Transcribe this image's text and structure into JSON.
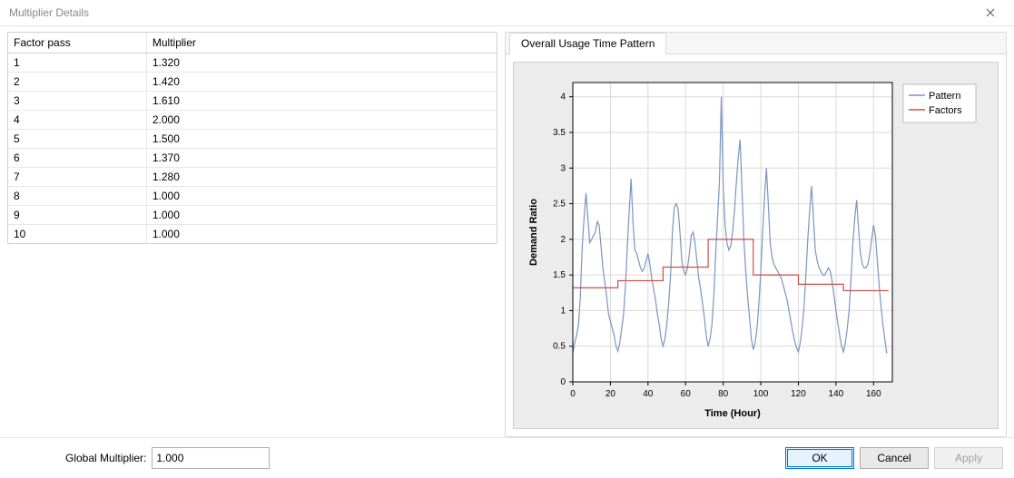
{
  "window": {
    "title": "Multiplier Details"
  },
  "table": {
    "headers": {
      "col0": "Factor pass",
      "col1": "Multiplier"
    },
    "rows": [
      {
        "pass": "1",
        "mult": "1.320"
      },
      {
        "pass": "2",
        "mult": "1.420"
      },
      {
        "pass": "3",
        "mult": "1.610"
      },
      {
        "pass": "4",
        "mult": "2.000"
      },
      {
        "pass": "5",
        "mult": "1.500"
      },
      {
        "pass": "6",
        "mult": "1.370"
      },
      {
        "pass": "7",
        "mult": "1.280"
      },
      {
        "pass": "8",
        "mult": "1.000"
      },
      {
        "pass": "9",
        "mult": "1.000"
      },
      {
        "pass": "10",
        "mult": "1.000"
      }
    ]
  },
  "tabs": {
    "overall": "Overall Usage Time Pattern"
  },
  "footer": {
    "global_label": "Global Multiplier:",
    "global_value": "1.000",
    "ok": "OK",
    "cancel": "Cancel",
    "apply": "Apply"
  },
  "chart_data": {
    "type": "line",
    "title": "",
    "xlabel": "Time (Hour)",
    "ylabel": "Demand Ratio",
    "xlim": [
      0,
      170
    ],
    "ylim": [
      0,
      4.2
    ],
    "xticks": [
      0,
      20,
      40,
      60,
      80,
      100,
      120,
      140,
      160
    ],
    "yticks": [
      0,
      0.5,
      1,
      1.5,
      2,
      2.5,
      3,
      3.5,
      4
    ],
    "legend": [
      "Pattern",
      "Factors"
    ],
    "colors": {
      "Pattern": "#7a95c0",
      "Factors": "#d34a4a",
      "grid": "#d9d9d9",
      "axis": "#000"
    },
    "series": [
      {
        "name": "Pattern",
        "x": [
          0,
          1,
          2,
          3,
          4,
          5,
          6,
          7,
          8,
          9,
          10,
          11,
          12,
          13,
          14,
          15,
          16,
          17,
          18,
          19,
          20,
          21,
          22,
          23,
          24,
          25,
          26,
          27,
          28,
          29,
          30,
          31,
          32,
          33,
          34,
          35,
          36,
          37,
          38,
          39,
          40,
          41,
          42,
          43,
          44,
          45,
          46,
          47,
          48,
          49,
          50,
          51,
          52,
          53,
          54,
          55,
          56,
          57,
          58,
          59,
          60,
          61,
          62,
          63,
          64,
          65,
          66,
          67,
          68,
          69,
          70,
          71,
          72,
          73,
          74,
          75,
          76,
          77,
          78,
          79,
          80,
          81,
          82,
          83,
          84,
          85,
          86,
          87,
          88,
          89,
          90,
          91,
          92,
          93,
          94,
          95,
          96,
          97,
          98,
          99,
          100,
          101,
          102,
          103,
          104,
          105,
          106,
          107,
          108,
          109,
          110,
          111,
          112,
          113,
          114,
          115,
          116,
          117,
          118,
          119,
          120,
          121,
          122,
          123,
          124,
          125,
          126,
          127,
          128,
          129,
          130,
          131,
          132,
          133,
          134,
          135,
          136,
          137,
          138,
          139,
          140,
          141,
          142,
          143,
          144,
          145,
          146,
          147,
          148,
          149,
          150,
          151,
          152,
          153,
          154,
          155,
          156,
          157,
          158,
          159,
          160,
          161,
          162,
          163,
          164,
          165,
          166,
          167
        ],
        "y": [
          0.4,
          0.55,
          0.65,
          0.8,
          1.2,
          1.9,
          2.3,
          2.65,
          2.3,
          1.95,
          2.0,
          2.05,
          2.1,
          2.25,
          2.2,
          1.9,
          1.6,
          1.4,
          1.2,
          0.95,
          0.85,
          0.75,
          0.65,
          0.5,
          0.43,
          0.55,
          0.75,
          0.95,
          1.35,
          1.9,
          2.4,
          2.85,
          2.25,
          1.85,
          1.8,
          1.7,
          1.6,
          1.55,
          1.6,
          1.7,
          1.8,
          1.65,
          1.45,
          1.3,
          1.15,
          0.95,
          0.8,
          0.6,
          0.5,
          0.6,
          0.8,
          1.1,
          1.5,
          2.1,
          2.45,
          2.5,
          2.43,
          2.1,
          1.7,
          1.55,
          1.5,
          1.6,
          1.8,
          2.05,
          2.1,
          1.95,
          1.7,
          1.45,
          1.3,
          1.1,
          0.9,
          0.65,
          0.5,
          0.6,
          0.8,
          1.2,
          1.8,
          2.3,
          2.8,
          4.0,
          2.75,
          2.2,
          1.95,
          1.85,
          1.9,
          2.1,
          2.4,
          2.8,
          3.15,
          3.4,
          2.7,
          2.0,
          1.55,
          1.2,
          0.9,
          0.6,
          0.45,
          0.55,
          0.75,
          1.1,
          1.55,
          2.1,
          2.6,
          3.0,
          2.5,
          1.95,
          1.75,
          1.65,
          1.6,
          1.55,
          1.5,
          1.45,
          1.35,
          1.25,
          1.15,
          1.0,
          0.85,
          0.7,
          0.58,
          0.48,
          0.42,
          0.55,
          0.75,
          1.05,
          1.5,
          2.0,
          2.4,
          2.75,
          2.3,
          1.85,
          1.7,
          1.6,
          1.55,
          1.5,
          1.5,
          1.55,
          1.6,
          1.55,
          1.4,
          1.2,
          1.0,
          0.82,
          0.65,
          0.5,
          0.42,
          0.55,
          0.75,
          1.0,
          1.45,
          1.95,
          2.3,
          2.55,
          2.15,
          1.8,
          1.65,
          1.6,
          1.6,
          1.65,
          1.8,
          2.0,
          2.2,
          2.05,
          1.7,
          1.35,
          1.05,
          0.8,
          0.6,
          0.4
        ]
      },
      {
        "name": "Factors",
        "stepped": true,
        "x": [
          0,
          24,
          48,
          72,
          96,
          120,
          144,
          168
        ],
        "y": [
          1.32,
          1.42,
          1.61,
          2.0,
          1.5,
          1.37,
          1.28,
          1.28
        ]
      }
    ]
  }
}
